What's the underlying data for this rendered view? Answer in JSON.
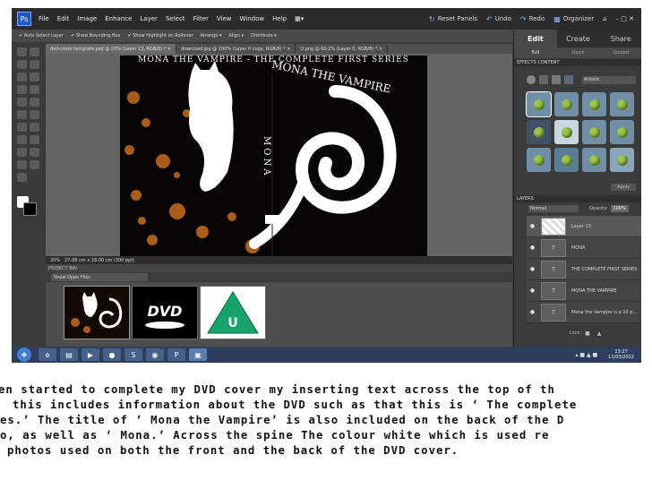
{
  "app": {
    "menu": [
      "File",
      "Edit",
      "Image",
      "Enhance",
      "Layer",
      "Select",
      "Filter",
      "View",
      "Window",
      "Help"
    ],
    "top_actions": {
      "reset_panels": "Reset Panels",
      "undo": "Undo",
      "redo": "Redo",
      "organizer": "Organizer"
    },
    "window_controls": "–  □  ✕"
  },
  "options_bar": {
    "auto_select": "✔ Auto Select Layer",
    "bounding_box": "✔ Show Bounding Box",
    "highlight": "✔ Show Highlight on Rollover",
    "arrange": "Arrange ▾",
    "align": "Align ▾",
    "distribute": "Distribute ▾"
  },
  "documents": {
    "tabs": [
      "dvd-cover-template.psd @ 20% (Layer 13, RGB/8) *  ×",
      "download.jpg @ 100% (Layer 0 copy, RGB/8) *  ×",
      "U.png @ 60.2% (Layer 0, RGB/8) *  ×"
    ]
  },
  "artwork": {
    "header": "MONA THE VAMPIRE - THE COMPLETE FIRST SERIES",
    "front_title": "MONA THE VAMPIRE",
    "spine": "MONA"
  },
  "status": {
    "zoom": "20%",
    "size": "27.06 cm x 18.00 cm (300 ppi)"
  },
  "project_bin": {
    "label": "PROJECT BIN",
    "select": "Show Open Files"
  },
  "panel": {
    "tabs": [
      "Edit",
      "Create",
      "Share"
    ],
    "sub_tabs": [
      "Full",
      "Quick",
      "Guided"
    ],
    "effects_label": "EFFECTS   CONTENT",
    "effects_dropdown": "Artistic",
    "apply": "Apply",
    "layers_label": "LAYERS",
    "blend_mode": "Normal",
    "opacity_label": "Opacity:",
    "opacity_value": "100%",
    "layers": [
      "Layer 13",
      "MONA",
      "THE COMPLETE FIRST SERIES",
      "MONA THE VAMPIRE",
      "Mona the Vampire is a 10 p..."
    ],
    "lock_label": "Lock:"
  },
  "taskbar": {
    "time": "23:27",
    "date": "11/03/2012"
  },
  "caption": {
    "lines": [
      "en started to complete my DVD cover my inserting text across the top of th",
      "this includes information about the DVD such as that this is ‘ The complete",
      "es.’  The title of ‘ Mona the Vampire’  is also included on the back of the D",
      "o, as well as ‘ Mona.’  Across the spine The colour white which is used re",
      "photos used on both the front and the back of the DVD cover."
    ]
  }
}
